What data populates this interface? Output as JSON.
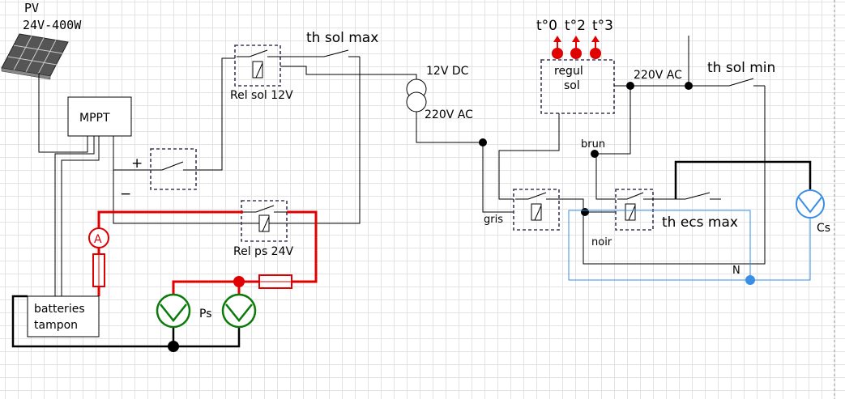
{
  "labels": {
    "pv_title": "PV",
    "pv_rating": "24V-400W",
    "mppt": "MPPT",
    "plus": "+",
    "minus": "−",
    "ammeter": "A",
    "batteries_line1": "batteries",
    "batteries_line2": "tampon",
    "ps": "Ps",
    "rel_sol": "Rel sol 12V",
    "rel_ps": "Rel ps 24V",
    "th_sol_max": "th sol max",
    "dc_12v": "12V DC",
    "ac_220v_transformer": "220V AC",
    "temp0": "t°0",
    "temp2": "t°2",
    "temp3": "t°3",
    "regul_line1": "regul",
    "regul_line2": "sol",
    "ac_220v_regul": "220V AC",
    "th_sol_min": "th sol min",
    "brun": "brun",
    "gris": "gris",
    "noir": "noir",
    "th_ecs_max": "th ecs max",
    "cs": "Cs",
    "neutral": "N"
  },
  "colors": {
    "wire": "#000000",
    "power_loop": "#e00000",
    "neutral_wire": "#3a8ee6",
    "pump_ps": "#0a7a0a",
    "pump_cs": "#3a8ee6",
    "sensor": "#e00000",
    "relay_outline": "#3a3a5a"
  },
  "icons": [
    "solar-panel-icon",
    "transformer-icon",
    "pump-icon",
    "relay-icon",
    "switch-icon",
    "fuse-icon",
    "ammeter-icon",
    "temperature-sensor-icon"
  ]
}
